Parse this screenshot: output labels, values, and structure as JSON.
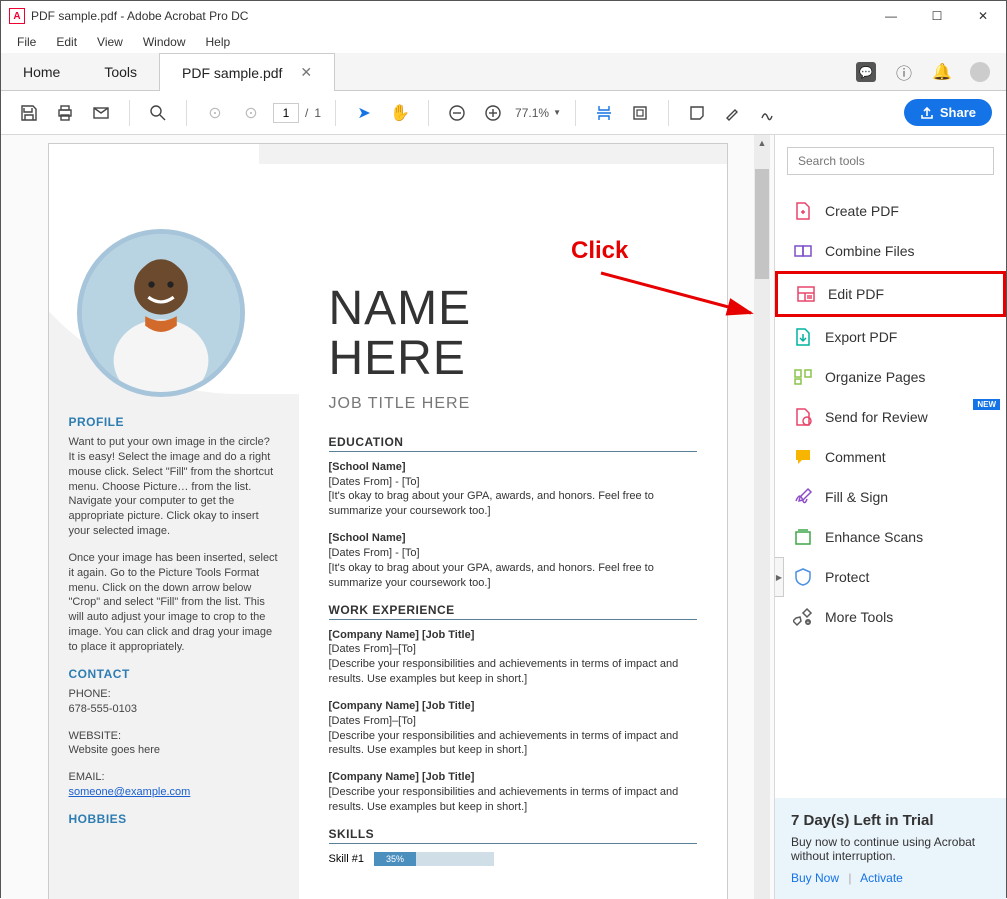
{
  "window": {
    "title": "PDF sample.pdf - Adobe Acrobat Pro DC"
  },
  "menu": [
    "File",
    "Edit",
    "View",
    "Window",
    "Help"
  ],
  "tabs": {
    "home": "Home",
    "tools": "Tools",
    "active": "PDF sample.pdf"
  },
  "toolbar": {
    "page_current": "1",
    "page_total": "1",
    "zoom": "77.1%",
    "share": "Share"
  },
  "search_placeholder": "Search tools",
  "tools_list": [
    {
      "label": "Create PDF",
      "color": "#e8456b"
    },
    {
      "label": "Combine Files",
      "color": "#7b4fc9"
    },
    {
      "label": "Edit PDF",
      "color": "#e8456b",
      "highlight": true
    },
    {
      "label": "Export PDF",
      "color": "#00b39f"
    },
    {
      "label": "Organize Pages",
      "color": "#8bc34a"
    },
    {
      "label": "Send for Review",
      "color": "#e8456b",
      "new": true
    },
    {
      "label": "Comment",
      "color": "#f7b500"
    },
    {
      "label": "Fill & Sign",
      "color": "#8e4ec9"
    },
    {
      "label": "Enhance Scans",
      "color": "#3fa648"
    },
    {
      "label": "Protect",
      "color": "#4a90e2"
    },
    {
      "label": "More Tools",
      "color": "#5a5a5a"
    }
  ],
  "trial": {
    "title": "7 Day(s) Left in Trial",
    "body": "Buy now to continue using Acrobat without interruption.",
    "buy": "Buy Now",
    "activate": "Activate"
  },
  "annotation": {
    "label": "Click"
  },
  "doc": {
    "name_line1": "NAME",
    "name_line2": "HERE",
    "job_title": "JOB TITLE HERE",
    "profile_h": "PROFILE",
    "profile_p1": "Want to put your own image in the circle?  It is easy!  Select the image and do a right mouse click.  Select \"Fill\" from the shortcut menu.  Choose Picture… from the list.  Navigate your computer to get the appropriate picture.  Click okay to insert your selected image.",
    "profile_p2": "Once your image has been inserted, select it again.  Go to the Picture Tools Format menu. Click on the down arrow below \"Crop\" and select \"Fill\" from the list.  This will auto adjust your image to crop to the image.  You can click and drag your image to place it appropriately.",
    "contact_h": "CONTACT",
    "phone_lbl": "PHONE:",
    "phone": "678-555-0103",
    "website_lbl": "WEBSITE:",
    "website": "Website goes here",
    "email_lbl": "EMAIL:",
    "email": "someone@example.com",
    "hobbies_h": "HOBBIES",
    "edu_h": "EDUCATION",
    "school": "[School Name]",
    "dates": "[Dates From] - [To]",
    "dates2": "[Dates From]–[To]",
    "edu_body": "[It's okay to brag about your GPA, awards, and honors. Feel free to summarize your coursework too.]",
    "work_h": "WORK EXPERIENCE",
    "company": "[Company Name]  [Job Title]",
    "work_body": "[Describe your responsibilities and achievements in terms of impact and results. Use examples but keep in short.]",
    "skills_h": "SKILLS",
    "skill1": "Skill #1",
    "skill1_pct": "35%"
  }
}
